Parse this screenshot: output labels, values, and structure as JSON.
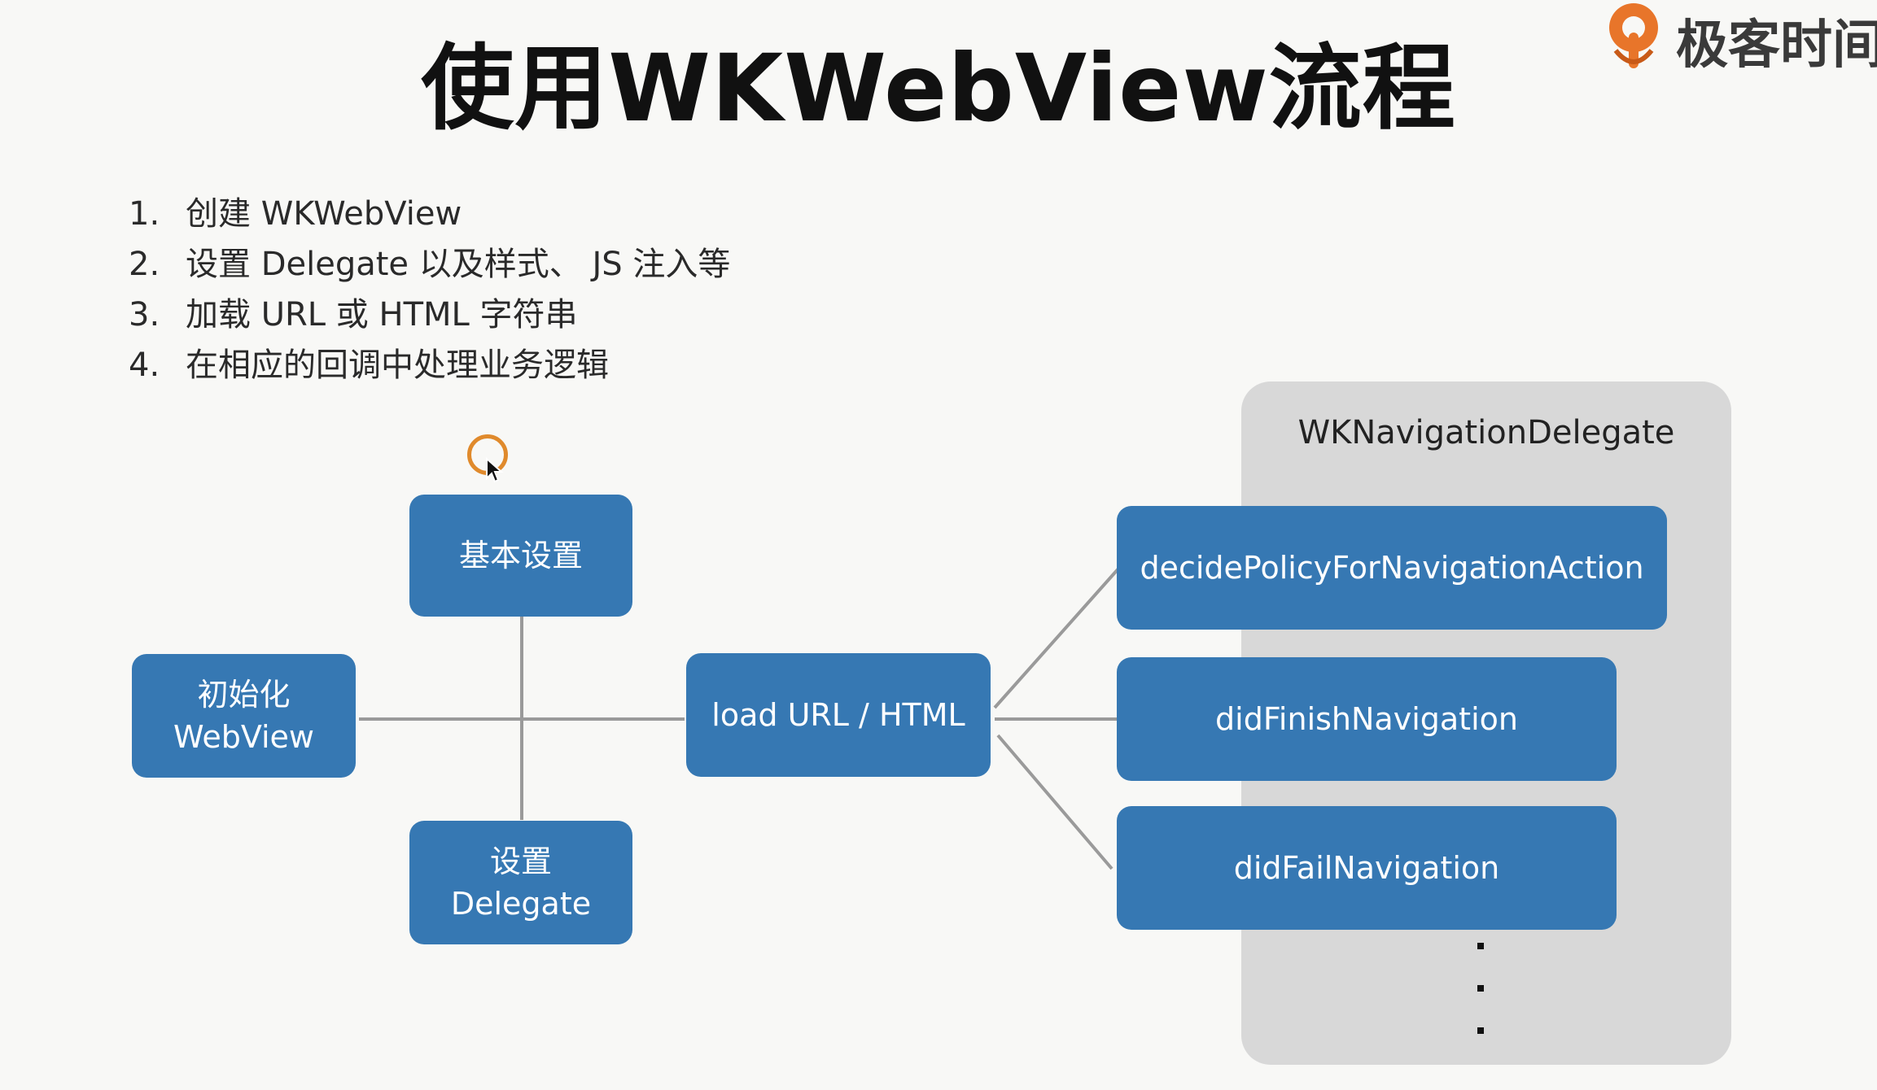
{
  "title": "使用WKWebView流程",
  "logo": {
    "text": "极客时间",
    "icon": "geektime-logo-icon",
    "color": "#e8752a"
  },
  "steps": [
    {
      "num": "1.",
      "text": "创建 WKWebView"
    },
    {
      "num": "2.",
      "text": "设置 Delegate 以及样式、 JS 注入等"
    },
    {
      "num": "3.",
      "text": "加载 URL 或 HTML 字符串"
    },
    {
      "num": "4.",
      "text": "在相应的回调中处理业务逻辑"
    }
  ],
  "nodes": {
    "init": "初始化\nWebView",
    "basic": "基本设置",
    "delegate": "设置\nDelegate",
    "load": "load URL / HTML"
  },
  "panel": {
    "title": "WKNavigationDelegate",
    "callbacks": [
      "decidePolicyForNavigationAction",
      "didFinishNavigation",
      "didFailNavigation"
    ]
  },
  "colors": {
    "box": "#3678b3",
    "panel": "#d8d8d8",
    "line": "#9a9a9a"
  }
}
